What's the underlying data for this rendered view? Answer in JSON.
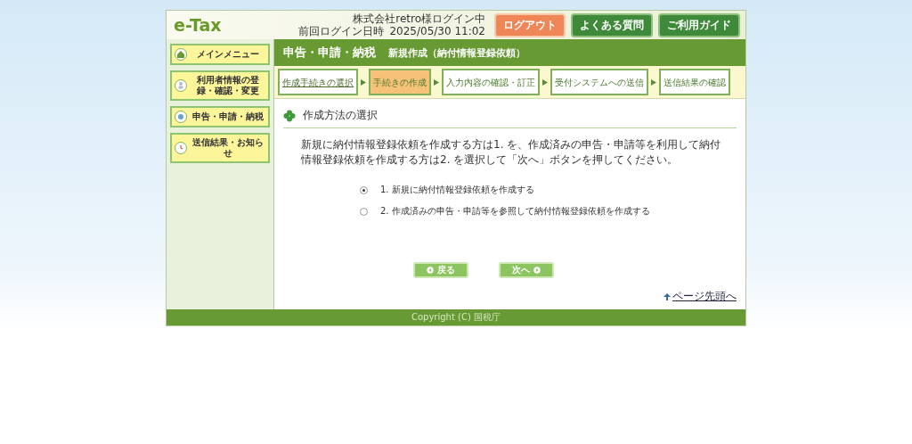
{
  "header": {
    "logo": "e-Tax",
    "user": "株式会社retro様ログイン中",
    "last_login_label": "前回ログイン日時",
    "last_login_value": "2025/05/30 11:02",
    "buttons": [
      {
        "label": "ログアウト",
        "kind": "logout"
      },
      {
        "label": "よくある質問",
        "kind": "help"
      },
      {
        "label": "ご利用ガイド",
        "kind": "help"
      }
    ]
  },
  "sidebar": {
    "items": [
      {
        "label": "メインメニュー"
      },
      {
        "label": "利用者情報の登録・確認・変更"
      },
      {
        "label": "申告・申請・納税"
      },
      {
        "label": "送信結果・お知らせ"
      }
    ]
  },
  "title_bar": {
    "title": "申告・申請・納税",
    "subtitle": "新規作成（納付情報登録依頼）"
  },
  "steps": [
    {
      "label": "作成手続きの選択",
      "link": true,
      "selected": false
    },
    {
      "label": "手続きの作成",
      "link": false,
      "selected": true
    },
    {
      "label": "入力内容の確認・訂正",
      "link": false,
      "selected": false
    },
    {
      "label": "受付システムへの送信",
      "link": false,
      "selected": false
    },
    {
      "label": "送信結果の確認",
      "link": false,
      "selected": false
    }
  ],
  "section": {
    "heading": "作成方法の選択",
    "description": "新規に納付情報登録依頼を作成する方は1. を、作成済みの申告・申請等を利用して納付情報登録依頼を作成する方は2. を選択して「次へ」ボタンを押してください。",
    "options": [
      {
        "label": "1. 新規に納付情報登録依頼を作成する",
        "selected": true
      },
      {
        "label": "2. 作成済みの申告・申請等を参照して納付情報登録依頼を作成する",
        "selected": false
      }
    ]
  },
  "nav_buttons": [
    {
      "label": "戻る",
      "kind": "back"
    },
    {
      "label": "次へ",
      "kind": "next"
    }
  ],
  "page_top": "ページ先頭へ",
  "footer": "Copyright (C) 国税庁"
}
